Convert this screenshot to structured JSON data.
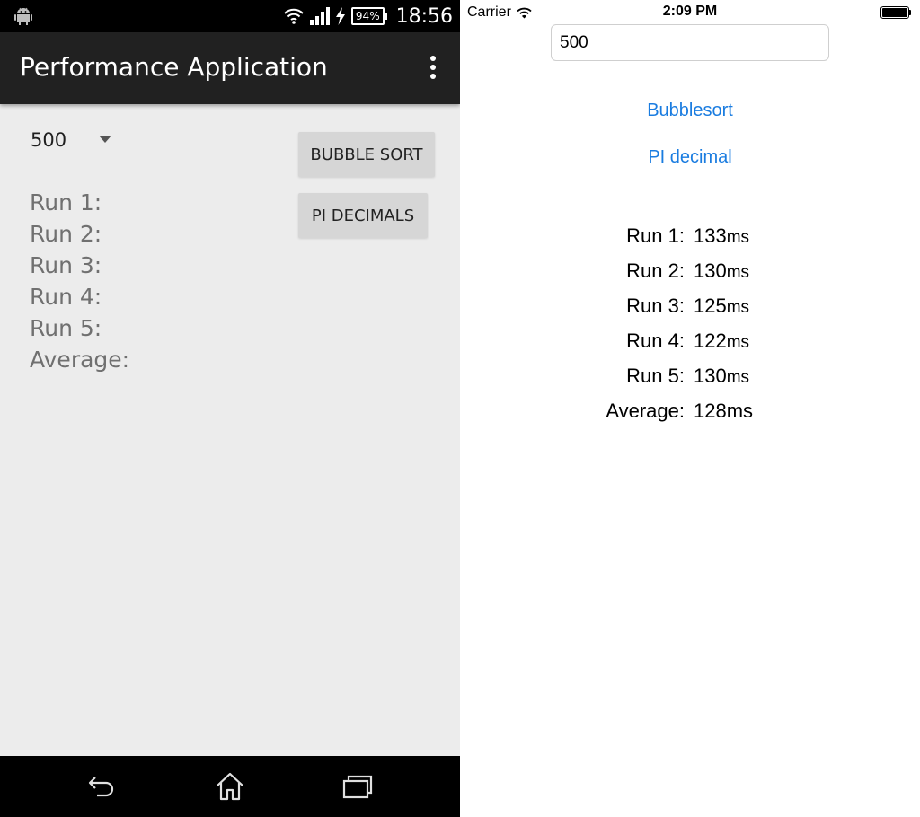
{
  "android": {
    "status_bar": {
      "battery_percent": "94%",
      "time": "18:56",
      "icons": [
        "android-robot-icon",
        "wifi-icon",
        "signal-icon",
        "charging-bolt-icon",
        "battery-icon"
      ]
    },
    "app_bar": {
      "title": "Performance Application",
      "overflow_icon": "overflow-menu-icon"
    },
    "spinner": {
      "value": "500",
      "icon": "dropdown-arrow-icon"
    },
    "buttons": {
      "bubble_sort": "BUBBLE SORT",
      "pi_decimals": "PI DECIMALS"
    },
    "results": {
      "run1": "Run 1:",
      "run2": "Run 2:",
      "run3": "Run 3:",
      "run4": "Run 4:",
      "run5": "Run 5:",
      "average": "Average:"
    },
    "nav_bar": {
      "icons": [
        "back-icon",
        "home-icon",
        "recents-icon"
      ]
    }
  },
  "ios": {
    "status_bar": {
      "carrier": "Carrier",
      "time": "2:09 PM",
      "icons": [
        "wifi-icon",
        "battery-icon"
      ]
    },
    "input": {
      "value": "500"
    },
    "links": {
      "bubblesort": "Bubblesort",
      "pi_decimal": "PI decimal"
    },
    "results": [
      {
        "label": "Run 1:",
        "value": "133",
        "unit": "ms"
      },
      {
        "label": "Run 2:",
        "value": "130",
        "unit": "ms"
      },
      {
        "label": "Run 3:",
        "value": "125",
        "unit": "ms"
      },
      {
        "label": "Run 4:",
        "value": "122",
        "unit": "ms"
      },
      {
        "label": "Run 5:",
        "value": "130",
        "unit": "ms"
      },
      {
        "label": "Average:",
        "value": "128",
        "unit": "ms"
      }
    ]
  },
  "colors": {
    "android_background": "#ececec",
    "android_appbar": "#212121",
    "android_button": "#d6d6d6",
    "android_result_text": "#707070",
    "ios_link": "#1a7ce0",
    "ios_field_border": "#cfcfcf"
  }
}
